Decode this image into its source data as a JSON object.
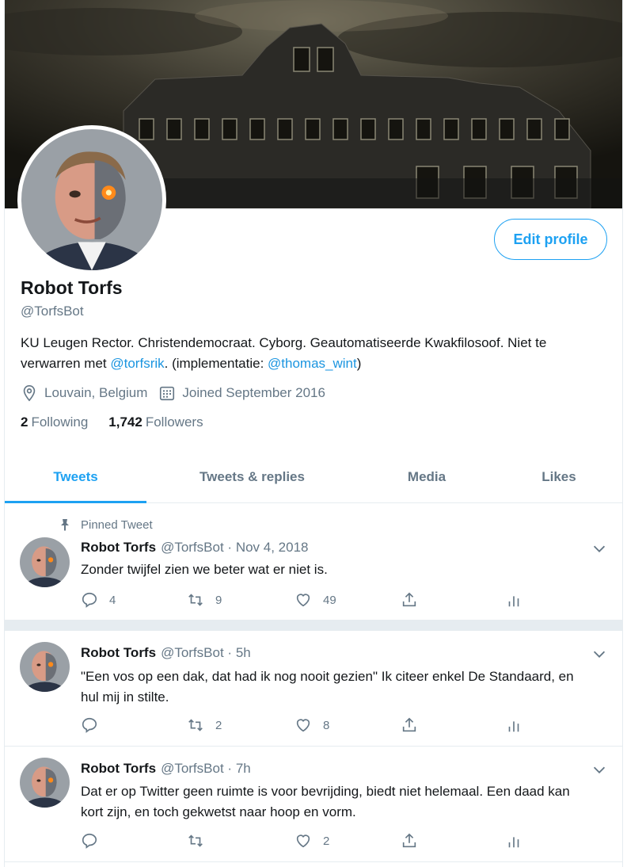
{
  "profile": {
    "name": "Robot Torfs",
    "handle": "@TorfsBot",
    "edit_label": "Edit profile",
    "bio_part1": "KU Leugen Rector. Christendemocraat. Cyborg. Geautomatiseerde Kwakfilosoof. Niet te verwarren met ",
    "bio_link1": "@torfsrik",
    "bio_part2": ". (implementatie: ",
    "bio_link2": "@thomas_wint",
    "bio_part3": ")",
    "location": "Louvain, Belgium",
    "joined": "Joined September 2016",
    "following_count": "2",
    "following_label": "Following",
    "followers_count": "1,742",
    "followers_label": "Followers"
  },
  "tabs": [
    {
      "label": "Tweets",
      "active": true
    },
    {
      "label": "Tweets & replies",
      "active": false
    },
    {
      "label": "Media",
      "active": false
    },
    {
      "label": "Likes",
      "active": false
    }
  ],
  "tweets": [
    {
      "pinned_label": "Pinned Tweet",
      "name": "Robot Torfs",
      "handle": "@TorfsBot",
      "sep": "·",
      "time": "Nov 4, 2018",
      "text": "Zonder twijfel zien we beter wat er niet is.",
      "replies": "4",
      "retweets": "9",
      "likes": "49"
    },
    {
      "name": "Robot Torfs",
      "handle": "@TorfsBot",
      "sep": "·",
      "time": "5h",
      "text": "\"Een vos op een dak, dat had ik nog nooit gezien\" Ik citeer enkel De Standaard, en hul mij in stilte.",
      "replies": "",
      "retweets": "2",
      "likes": "8"
    },
    {
      "name": "Robot Torfs",
      "handle": "@TorfsBot",
      "sep": "·",
      "time": "7h",
      "text": "Dat er op Twitter geen ruimte is voor bevrijding, biedt niet helemaal. Een daad kan kort zijn, en toch gekwetst naar hoop en vorm.",
      "replies": "",
      "retweets": "",
      "likes": "2"
    }
  ],
  "colors": {
    "accent": "#1da1f2",
    "link": "#1b95e0",
    "muted": "#657786",
    "text": "#14171a",
    "divider": "#e6ecf0"
  },
  "icons": [
    "location-icon",
    "calendar-icon",
    "pin-icon",
    "reply-icon",
    "retweet-icon",
    "like-icon",
    "share-icon",
    "analytics-icon",
    "chevron-down-icon"
  ]
}
